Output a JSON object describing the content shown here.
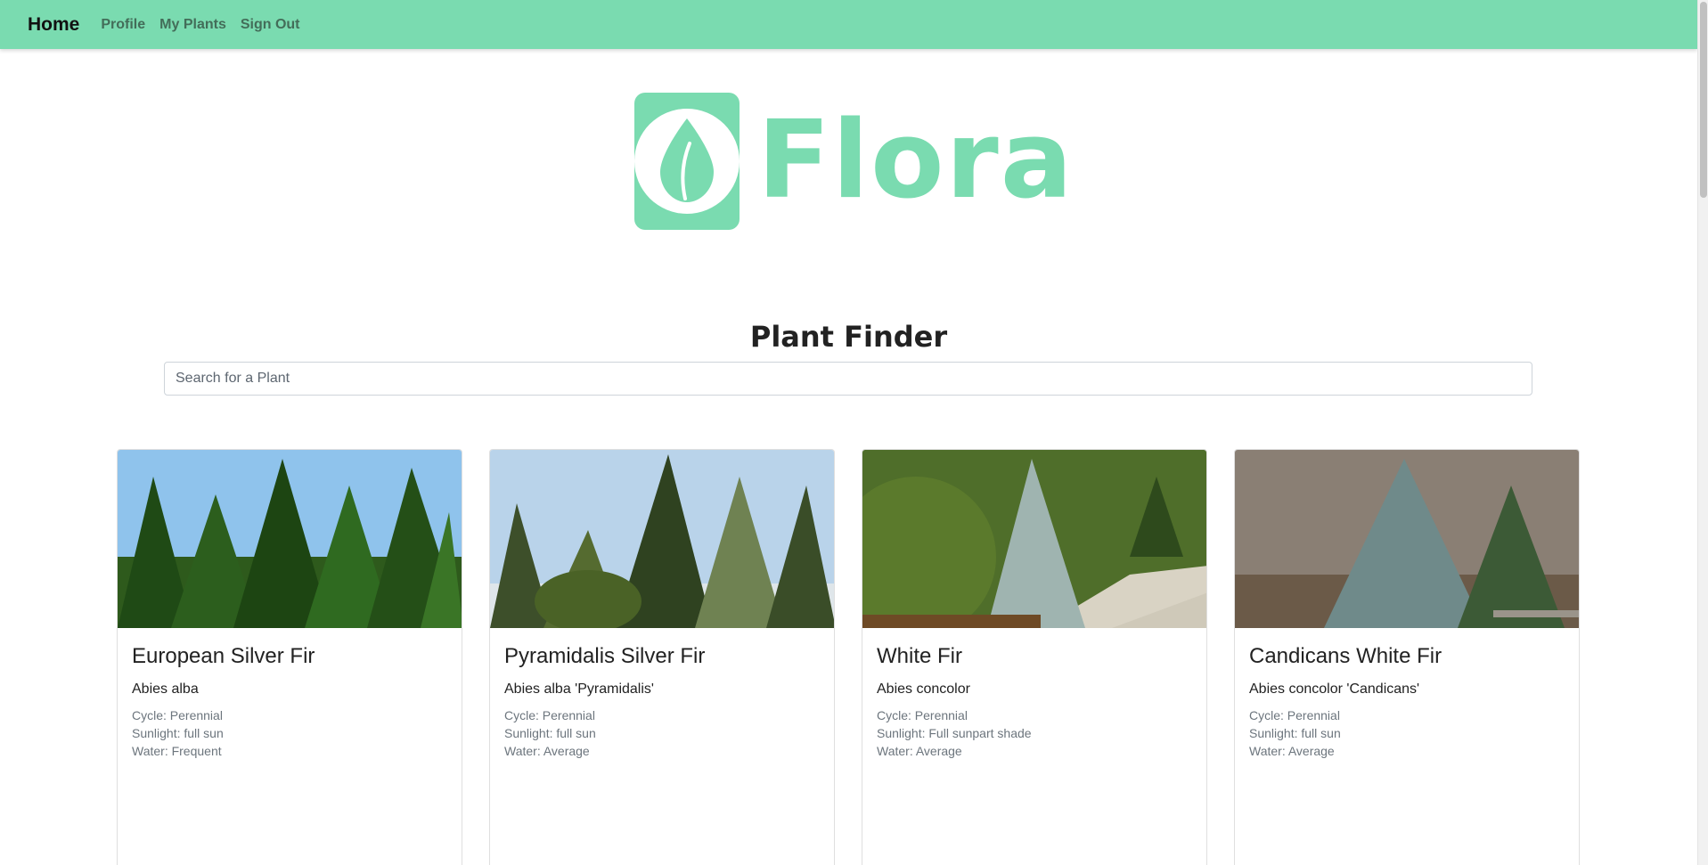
{
  "nav": {
    "brand": "Home",
    "links": [
      "Profile",
      "My Plants",
      "Sign Out"
    ]
  },
  "logo": {
    "text": "Flora",
    "color": "#7adbb0"
  },
  "finder": {
    "title": "Plant Finder",
    "placeholder": "Search for a Plant"
  },
  "plants": [
    {
      "name": "European Silver Fir",
      "scientific": "Abies alba",
      "cycle": "Cycle: Perennial",
      "sunlight": "Sunlight: full sun",
      "water": "Water: Frequent"
    },
    {
      "name": "Pyramidalis Silver Fir",
      "scientific": "Abies alba 'Pyramidalis'",
      "cycle": "Cycle: Perennial",
      "sunlight": "Sunlight: full sun",
      "water": "Water: Average"
    },
    {
      "name": "White Fir",
      "scientific": "Abies concolor",
      "cycle": "Cycle: Perennial",
      "sunlight": "Sunlight: Full sunpart shade",
      "water": "Water: Average"
    },
    {
      "name": "Candicans White Fir",
      "scientific": "Abies concolor 'Candicans'",
      "cycle": "Cycle: Perennial",
      "sunlight": "Sunlight: full sun",
      "water": "Water: Average"
    }
  ]
}
